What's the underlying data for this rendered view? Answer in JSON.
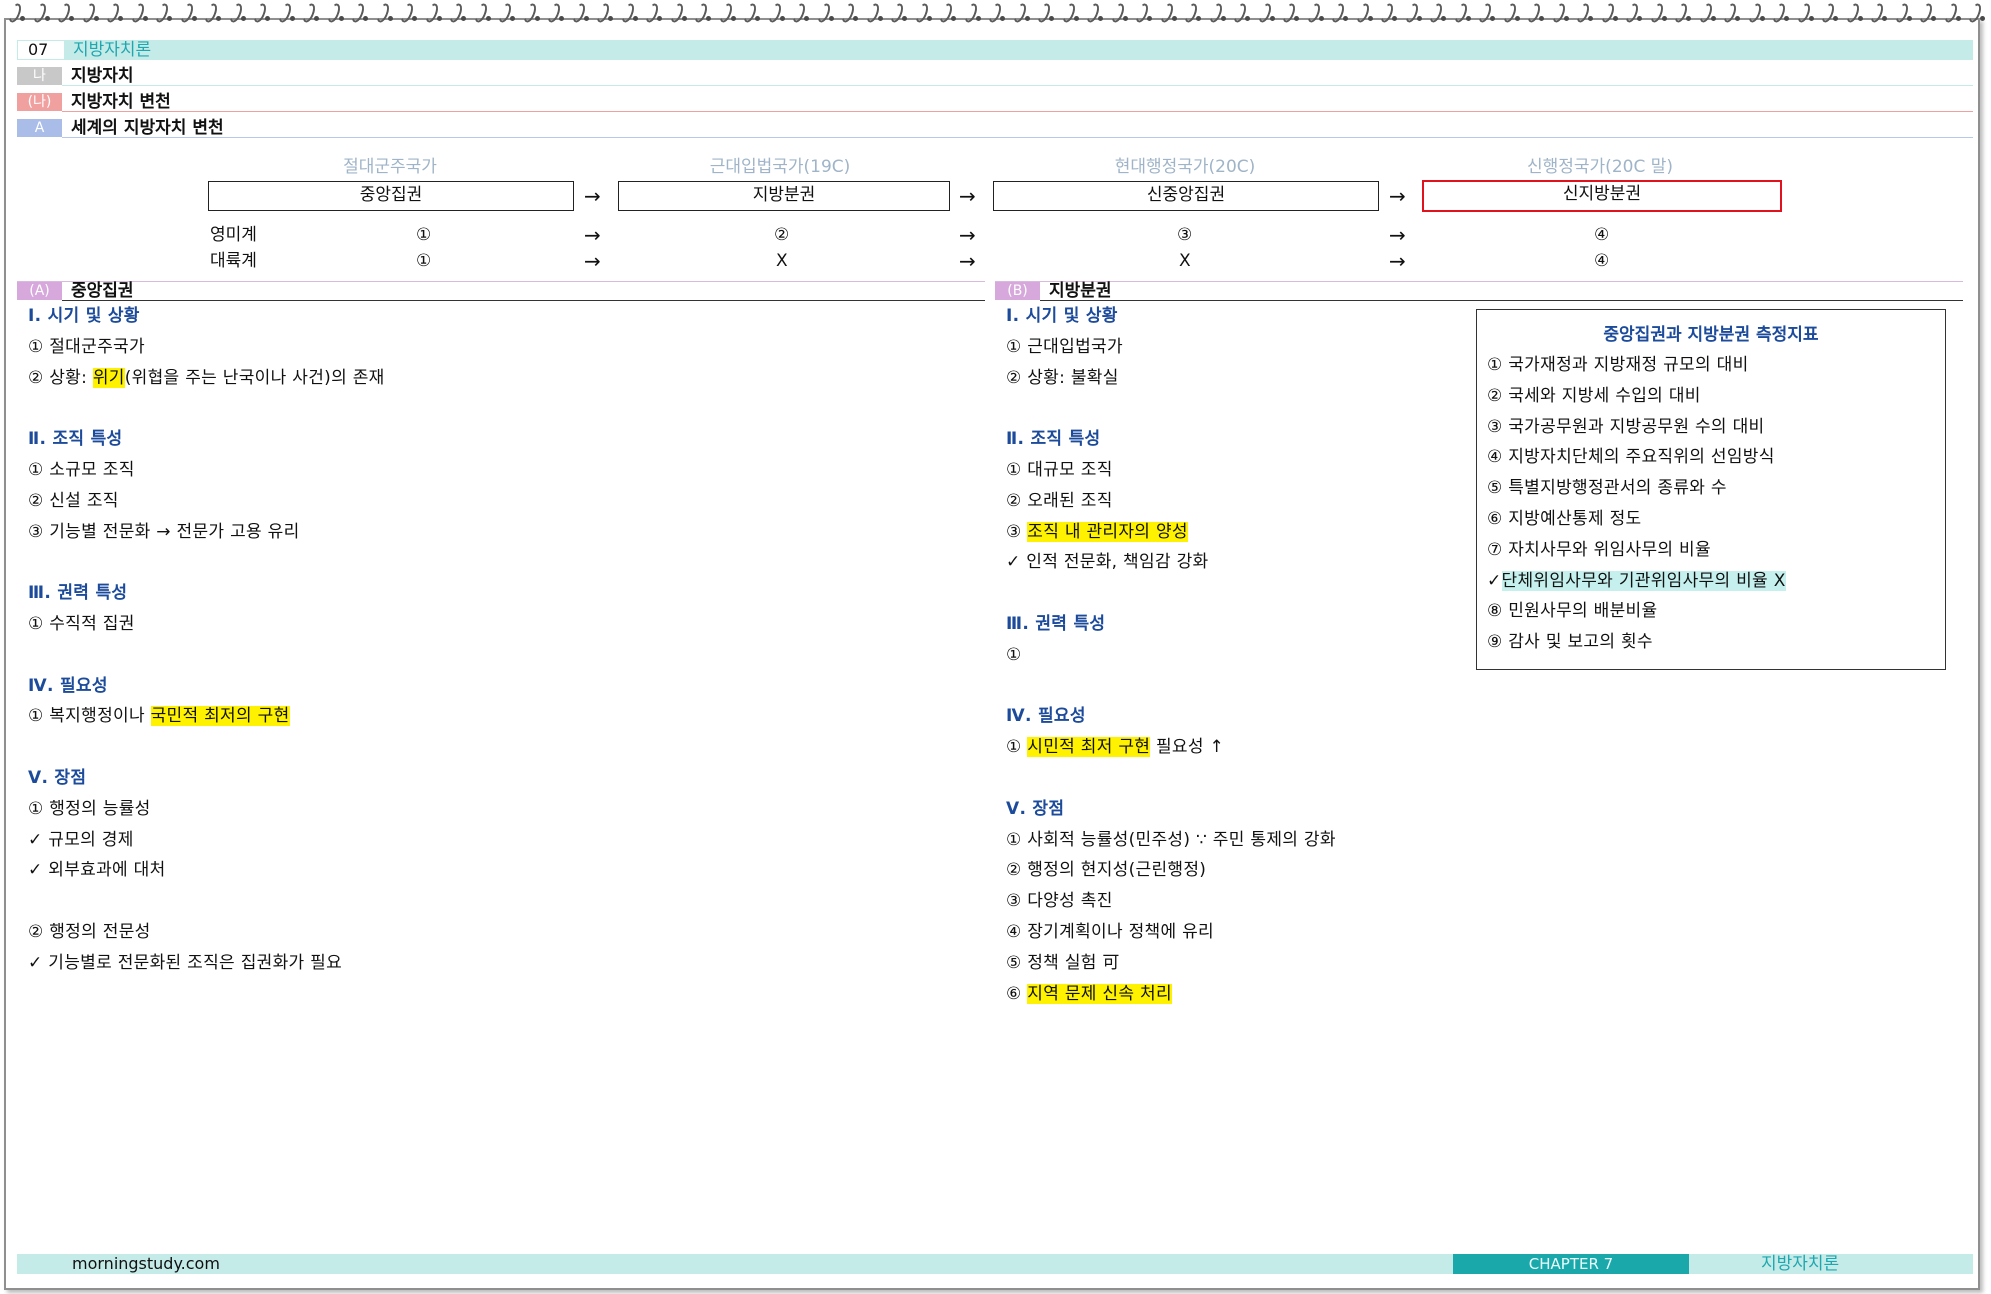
{
  "chapter": {
    "number": "07",
    "title": "지방자치론"
  },
  "headers": [
    {
      "tag": "나",
      "label": "지방자치",
      "color": "#c8c8c8",
      "rule": "#c5ebe8"
    },
    {
      "tag": "(나)",
      "label": "지방자치 변천",
      "color": "#f1a0a0",
      "rule": "#f1a0a0"
    },
    {
      "tag": "A",
      "label": "세계의 지방자치 변천",
      "color": "#a9bde8",
      "rule": "#b7c8ee"
    }
  ],
  "timeline": {
    "eras": [
      "절대군주국가",
      "근대입법국가(19C)",
      "현대행정국가(20C)",
      "신행정국가(20C 말)"
    ],
    "boxes": [
      "중앙집권",
      "지방분권",
      "신중앙집권",
      "신지방분권"
    ],
    "arrow": "→",
    "rows": [
      {
        "label": "영미계",
        "values": [
          "①",
          "②",
          "③",
          "④"
        ]
      },
      {
        "label": "대륙계",
        "values": [
          "①",
          "X",
          "X",
          "④"
        ]
      }
    ]
  },
  "sectionA": {
    "tag": "(A)",
    "label": "중앙집권",
    "color": "#d7a8dc",
    "lines": [
      {
        "type": "head",
        "text": "Ⅰ. 시기 및 상황"
      },
      {
        "type": "text",
        "parts": [
          {
            "t": "① 절대군주국가"
          }
        ]
      },
      {
        "type": "text",
        "parts": [
          {
            "t": "② 상황: "
          },
          {
            "t": "위기",
            "hl": "y"
          },
          {
            "t": "(위협을 주는 난국이나 사건)의 존재"
          }
        ]
      },
      {
        "type": "blank"
      },
      {
        "type": "head",
        "text": "Ⅱ. 조직 특성"
      },
      {
        "type": "text",
        "parts": [
          {
            "t": "① 소규모 조직"
          }
        ]
      },
      {
        "type": "text",
        "parts": [
          {
            "t": "② 신설 조직"
          }
        ]
      },
      {
        "type": "text",
        "parts": [
          {
            "t": "③ 기능별 전문화 → 전문가 고용 유리"
          }
        ]
      },
      {
        "type": "blank"
      },
      {
        "type": "head",
        "text": "Ⅲ. 권력 특성"
      },
      {
        "type": "text",
        "parts": [
          {
            "t": "① 수직적 집권"
          }
        ]
      },
      {
        "type": "blank"
      },
      {
        "type": "head",
        "text": "Ⅳ. 필요성"
      },
      {
        "type": "text",
        "parts": [
          {
            "t": "① 복지행정이나 "
          },
          {
            "t": "국민적 최저의 구현",
            "hl": "y"
          }
        ]
      },
      {
        "type": "blank"
      },
      {
        "type": "head",
        "text": "Ⅴ. 장점"
      },
      {
        "type": "text",
        "parts": [
          {
            "t": "① 행정의 능률성"
          }
        ]
      },
      {
        "type": "text",
        "parts": [
          {
            "t": "✓ 규모의 경제"
          }
        ]
      },
      {
        "type": "text",
        "parts": [
          {
            "t": "✓ 외부효과에 대처"
          }
        ]
      },
      {
        "type": "blank"
      },
      {
        "type": "text",
        "parts": [
          {
            "t": "② 행정의 전문성"
          }
        ]
      },
      {
        "type": "text",
        "parts": [
          {
            "t": "✓ 기능별로 전문화된 조직은 집권화가 필요"
          }
        ]
      }
    ]
  },
  "sectionB": {
    "tag": "(B)",
    "label": "지방분권",
    "color": "#d7a8dc",
    "lines": [
      {
        "type": "head",
        "text": "Ⅰ. 시기 및 상황"
      },
      {
        "type": "text",
        "parts": [
          {
            "t": "① 근대입법국가"
          }
        ]
      },
      {
        "type": "text",
        "parts": [
          {
            "t": "② 상황: 불확실"
          }
        ]
      },
      {
        "type": "blank"
      },
      {
        "type": "head",
        "text": "Ⅱ. 조직 특성"
      },
      {
        "type": "text",
        "parts": [
          {
            "t": "① 대규모 조직"
          }
        ]
      },
      {
        "type": "text",
        "parts": [
          {
            "t": "② 오래된 조직"
          }
        ]
      },
      {
        "type": "text",
        "parts": [
          {
            "t": "③ "
          },
          {
            "t": "조직 내 관리자의 양성",
            "hl": "y"
          }
        ]
      },
      {
        "type": "text",
        "parts": [
          {
            "t": "✓ 인적 전문화, 책임감 강화"
          }
        ]
      },
      {
        "type": "blank"
      },
      {
        "type": "head",
        "text": "Ⅲ. 권력 특성"
      },
      {
        "type": "text",
        "parts": [
          {
            "t": "①"
          }
        ]
      },
      {
        "type": "blank"
      },
      {
        "type": "head",
        "text": "Ⅳ. 필요성"
      },
      {
        "type": "text",
        "parts": [
          {
            "t": "① "
          },
          {
            "t": "시민적 최저 구현",
            "hl": "y"
          },
          {
            "t": " 필요성 ↑"
          }
        ]
      },
      {
        "type": "blank"
      },
      {
        "type": "head",
        "text": "Ⅴ. 장점"
      },
      {
        "type": "text",
        "parts": [
          {
            "t": "① 사회적 능률성(민주성) ∵ 주민 통제의 강화"
          }
        ]
      },
      {
        "type": "text",
        "parts": [
          {
            "t": "② 행정의 현지성(근린행정)"
          }
        ]
      },
      {
        "type": "text",
        "parts": [
          {
            "t": "③ 다양성 촉진"
          }
        ]
      },
      {
        "type": "text",
        "parts": [
          {
            "t": "④ 장기계획이나 정책에 유리"
          }
        ]
      },
      {
        "type": "text",
        "parts": [
          {
            "t": "⑤ 정책 실험 可"
          }
        ]
      },
      {
        "type": "text",
        "parts": [
          {
            "t": "⑥ "
          },
          {
            "t": "지역 문제 신속 처리",
            "hl": "y"
          }
        ]
      }
    ]
  },
  "measures": {
    "title": "중앙집권과 지방분권 측정지표",
    "items": [
      {
        "parts": [
          {
            "t": "① 국가재정과 지방재정 규모의 대비"
          }
        ]
      },
      {
        "parts": [
          {
            "t": "② 국세와 지방세 수입의 대비"
          }
        ]
      },
      {
        "parts": [
          {
            "t": "③ 국가공무원과 지방공무원 수의 대비"
          }
        ]
      },
      {
        "parts": [
          {
            "t": "④ 지방자치단체의 주요직위의 선임방식"
          }
        ]
      },
      {
        "parts": [
          {
            "t": "⑤ 특별지방행정관서의 종류와 수"
          }
        ]
      },
      {
        "parts": [
          {
            "t": "⑥ 지방예산통제 정도"
          }
        ]
      },
      {
        "parts": [
          {
            "t": "⑦ 자치사무와 위임사무의 비율"
          }
        ]
      },
      {
        "parts": [
          {
            "t": "✓"
          },
          {
            "t": "단체위임사무와 기관위임사무의 비율 X",
            "hl": "c"
          }
        ]
      },
      {
        "parts": [
          {
            "t": "⑧ 민원사무의 배분비율"
          }
        ]
      },
      {
        "parts": [
          {
            "t": "⑨ 감사 및 보고의 횟수"
          }
        ]
      }
    ]
  },
  "footer": {
    "site": "morningstudy.com",
    "chapter": "CHAPTER 7",
    "title": "지방자치론"
  },
  "colors": {
    "teal_bar": "#c5ebe8",
    "teal_dark": "#1aa8ab",
    "head_blue": "#1d4b9b",
    "highlight_yellow": "#fff200",
    "highlight_cyan": "#c5f0ee",
    "red_box": "#e1121d"
  }
}
